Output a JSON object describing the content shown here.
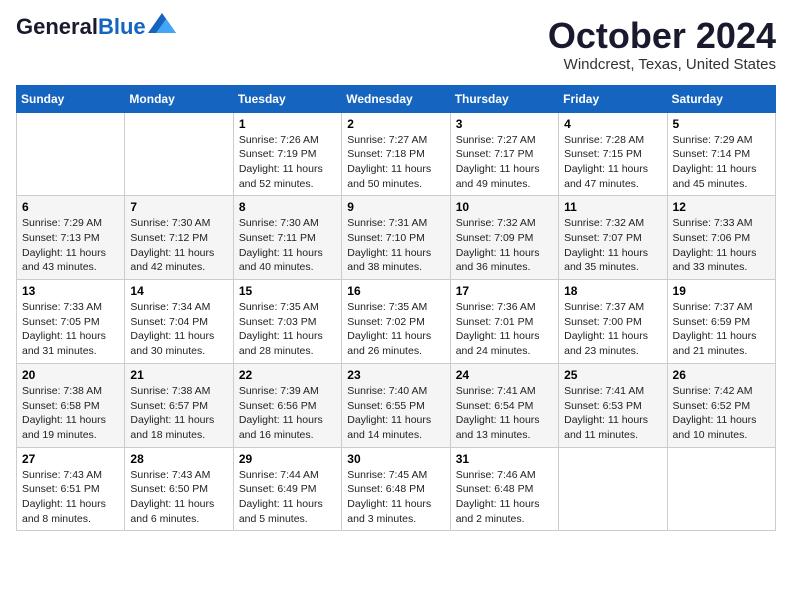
{
  "header": {
    "logo_line1": "General",
    "logo_line2": "Blue",
    "month_title": "October 2024",
    "location": "Windcrest, Texas, United States"
  },
  "weekdays": [
    "Sunday",
    "Monday",
    "Tuesday",
    "Wednesday",
    "Thursday",
    "Friday",
    "Saturday"
  ],
  "rows": [
    [
      {
        "day": "",
        "sunrise": "",
        "sunset": "",
        "daylight": ""
      },
      {
        "day": "",
        "sunrise": "",
        "sunset": "",
        "daylight": ""
      },
      {
        "day": "1",
        "sunrise": "Sunrise: 7:26 AM",
        "sunset": "Sunset: 7:19 PM",
        "daylight": "Daylight: 11 hours and 52 minutes."
      },
      {
        "day": "2",
        "sunrise": "Sunrise: 7:27 AM",
        "sunset": "Sunset: 7:18 PM",
        "daylight": "Daylight: 11 hours and 50 minutes."
      },
      {
        "day": "3",
        "sunrise": "Sunrise: 7:27 AM",
        "sunset": "Sunset: 7:17 PM",
        "daylight": "Daylight: 11 hours and 49 minutes."
      },
      {
        "day": "4",
        "sunrise": "Sunrise: 7:28 AM",
        "sunset": "Sunset: 7:15 PM",
        "daylight": "Daylight: 11 hours and 47 minutes."
      },
      {
        "day": "5",
        "sunrise": "Sunrise: 7:29 AM",
        "sunset": "Sunset: 7:14 PM",
        "daylight": "Daylight: 11 hours and 45 minutes."
      }
    ],
    [
      {
        "day": "6",
        "sunrise": "Sunrise: 7:29 AM",
        "sunset": "Sunset: 7:13 PM",
        "daylight": "Daylight: 11 hours and 43 minutes."
      },
      {
        "day": "7",
        "sunrise": "Sunrise: 7:30 AM",
        "sunset": "Sunset: 7:12 PM",
        "daylight": "Daylight: 11 hours and 42 minutes."
      },
      {
        "day": "8",
        "sunrise": "Sunrise: 7:30 AM",
        "sunset": "Sunset: 7:11 PM",
        "daylight": "Daylight: 11 hours and 40 minutes."
      },
      {
        "day": "9",
        "sunrise": "Sunrise: 7:31 AM",
        "sunset": "Sunset: 7:10 PM",
        "daylight": "Daylight: 11 hours and 38 minutes."
      },
      {
        "day": "10",
        "sunrise": "Sunrise: 7:32 AM",
        "sunset": "Sunset: 7:09 PM",
        "daylight": "Daylight: 11 hours and 36 minutes."
      },
      {
        "day": "11",
        "sunrise": "Sunrise: 7:32 AM",
        "sunset": "Sunset: 7:07 PM",
        "daylight": "Daylight: 11 hours and 35 minutes."
      },
      {
        "day": "12",
        "sunrise": "Sunrise: 7:33 AM",
        "sunset": "Sunset: 7:06 PM",
        "daylight": "Daylight: 11 hours and 33 minutes."
      }
    ],
    [
      {
        "day": "13",
        "sunrise": "Sunrise: 7:33 AM",
        "sunset": "Sunset: 7:05 PM",
        "daylight": "Daylight: 11 hours and 31 minutes."
      },
      {
        "day": "14",
        "sunrise": "Sunrise: 7:34 AM",
        "sunset": "Sunset: 7:04 PM",
        "daylight": "Daylight: 11 hours and 30 minutes."
      },
      {
        "day": "15",
        "sunrise": "Sunrise: 7:35 AM",
        "sunset": "Sunset: 7:03 PM",
        "daylight": "Daylight: 11 hours and 28 minutes."
      },
      {
        "day": "16",
        "sunrise": "Sunrise: 7:35 AM",
        "sunset": "Sunset: 7:02 PM",
        "daylight": "Daylight: 11 hours and 26 minutes."
      },
      {
        "day": "17",
        "sunrise": "Sunrise: 7:36 AM",
        "sunset": "Sunset: 7:01 PM",
        "daylight": "Daylight: 11 hours and 24 minutes."
      },
      {
        "day": "18",
        "sunrise": "Sunrise: 7:37 AM",
        "sunset": "Sunset: 7:00 PM",
        "daylight": "Daylight: 11 hours and 23 minutes."
      },
      {
        "day": "19",
        "sunrise": "Sunrise: 7:37 AM",
        "sunset": "Sunset: 6:59 PM",
        "daylight": "Daylight: 11 hours and 21 minutes."
      }
    ],
    [
      {
        "day": "20",
        "sunrise": "Sunrise: 7:38 AM",
        "sunset": "Sunset: 6:58 PM",
        "daylight": "Daylight: 11 hours and 19 minutes."
      },
      {
        "day": "21",
        "sunrise": "Sunrise: 7:38 AM",
        "sunset": "Sunset: 6:57 PM",
        "daylight": "Daylight: 11 hours and 18 minutes."
      },
      {
        "day": "22",
        "sunrise": "Sunrise: 7:39 AM",
        "sunset": "Sunset: 6:56 PM",
        "daylight": "Daylight: 11 hours and 16 minutes."
      },
      {
        "day": "23",
        "sunrise": "Sunrise: 7:40 AM",
        "sunset": "Sunset: 6:55 PM",
        "daylight": "Daylight: 11 hours and 14 minutes."
      },
      {
        "day": "24",
        "sunrise": "Sunrise: 7:41 AM",
        "sunset": "Sunset: 6:54 PM",
        "daylight": "Daylight: 11 hours and 13 minutes."
      },
      {
        "day": "25",
        "sunrise": "Sunrise: 7:41 AM",
        "sunset": "Sunset: 6:53 PM",
        "daylight": "Daylight: 11 hours and 11 minutes."
      },
      {
        "day": "26",
        "sunrise": "Sunrise: 7:42 AM",
        "sunset": "Sunset: 6:52 PM",
        "daylight": "Daylight: 11 hours and 10 minutes."
      }
    ],
    [
      {
        "day": "27",
        "sunrise": "Sunrise: 7:43 AM",
        "sunset": "Sunset: 6:51 PM",
        "daylight": "Daylight: 11 hours and 8 minutes."
      },
      {
        "day": "28",
        "sunrise": "Sunrise: 7:43 AM",
        "sunset": "Sunset: 6:50 PM",
        "daylight": "Daylight: 11 hours and 6 minutes."
      },
      {
        "day": "29",
        "sunrise": "Sunrise: 7:44 AM",
        "sunset": "Sunset: 6:49 PM",
        "daylight": "Daylight: 11 hours and 5 minutes."
      },
      {
        "day": "30",
        "sunrise": "Sunrise: 7:45 AM",
        "sunset": "Sunset: 6:48 PM",
        "daylight": "Daylight: 11 hours and 3 minutes."
      },
      {
        "day": "31",
        "sunrise": "Sunrise: 7:46 AM",
        "sunset": "Sunset: 6:48 PM",
        "daylight": "Daylight: 11 hours and 2 minutes."
      },
      {
        "day": "",
        "sunrise": "",
        "sunset": "",
        "daylight": ""
      },
      {
        "day": "",
        "sunrise": "",
        "sunset": "",
        "daylight": ""
      }
    ]
  ]
}
